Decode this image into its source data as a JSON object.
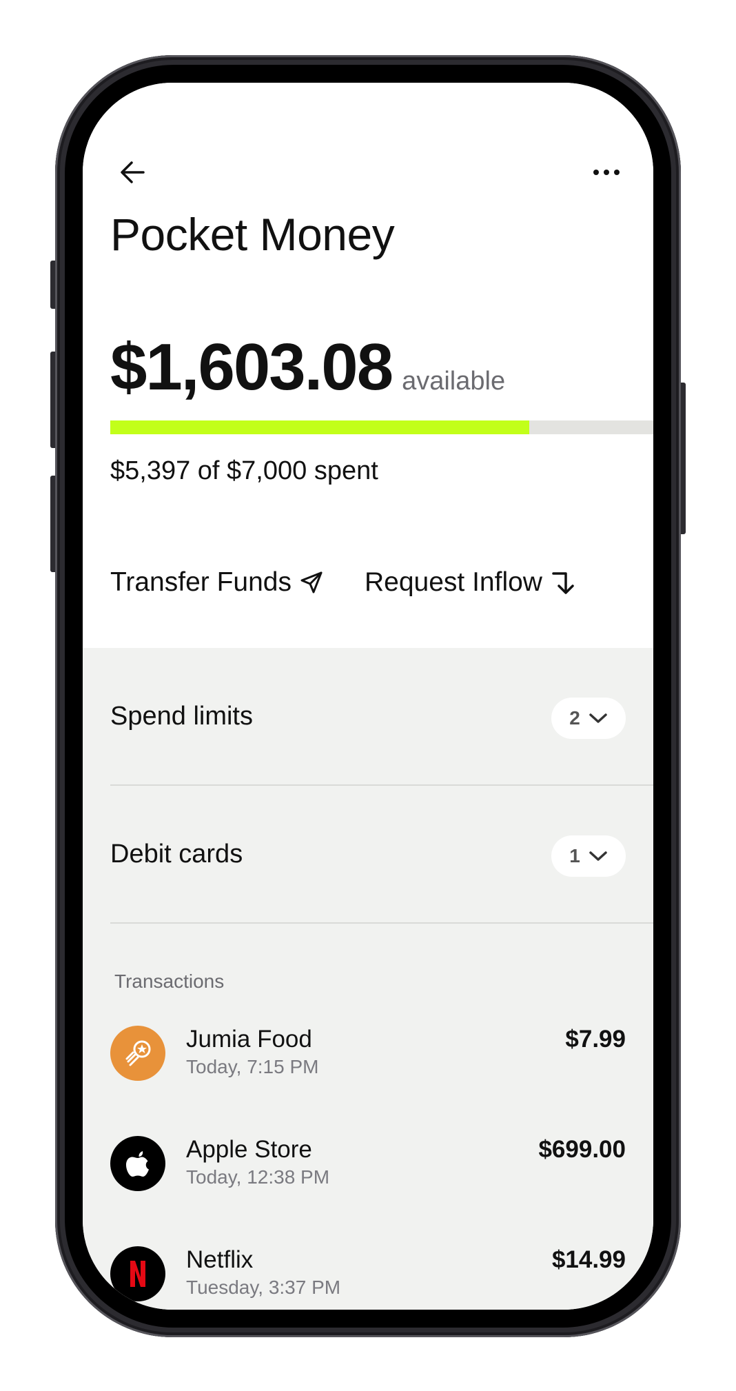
{
  "header": {
    "back_icon": "arrow-left-icon",
    "more_icon": "more-horizontal-icon",
    "title": "Pocket Money"
  },
  "balance": {
    "amount": "$1,603.08",
    "available_label": "available",
    "spent_fraction": 0.771,
    "spent_text": "$5,397 of $7,000 spent"
  },
  "colors": {
    "progress_fill": "#c2ff1a",
    "progress_track": "#e3e3e0",
    "section_bg": "#f1f2f0"
  },
  "actions": [
    {
      "label": "Transfer Funds",
      "icon": "send-icon"
    },
    {
      "label": "Request Inflow",
      "icon": "arrow-turn-down-icon"
    }
  ],
  "sections": {
    "spend_limits": {
      "label": "Spend limits",
      "count": "2"
    },
    "debit_cards": {
      "label": "Debit cards",
      "count": "1"
    }
  },
  "transactions": {
    "heading": "Transactions",
    "items": [
      {
        "merchant": "Jumia Food",
        "time": "Today, 7:15 PM",
        "amount": "$7.99",
        "icon": "jumia-food-logo-icon",
        "icon_color": "#e8923a"
      },
      {
        "merchant": "Apple Store",
        "time": "Today, 12:38 PM",
        "amount": "$699.00",
        "icon": "apple-logo-icon",
        "icon_color": "#000000"
      },
      {
        "merchant": "Netflix",
        "time": "Tuesday, 3:37 PM",
        "amount": "$14.99",
        "icon": "netflix-logo-icon",
        "icon_color": "#000000"
      }
    ]
  }
}
